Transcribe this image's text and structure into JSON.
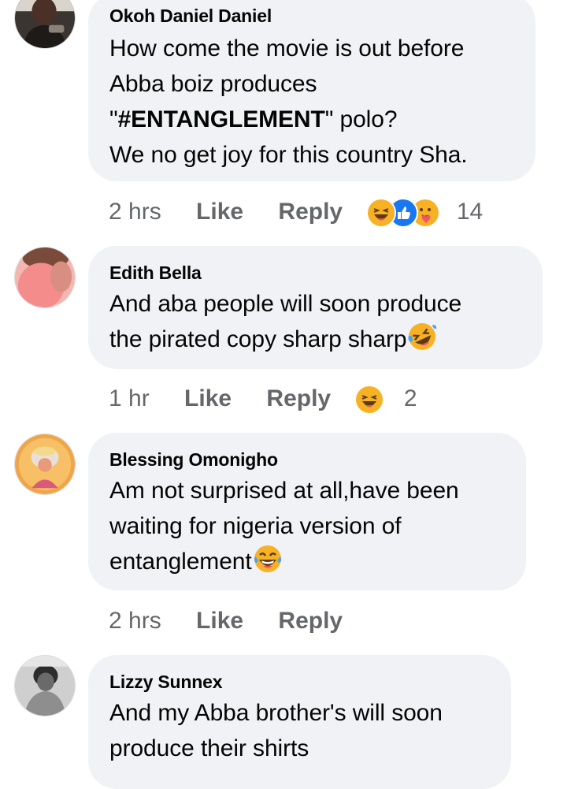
{
  "comments": [
    {
      "author": "Okoh Daniel Daniel",
      "lines": [
        "How come the movie is out before",
        "Abba boiz produces",
        "\"",
        "#ENTANGLEMENT",
        "\" polo?",
        "We no get joy for this country Sha."
      ],
      "time": "2 hrs",
      "like": "Like",
      "reply": "Reply",
      "reaction_icons": [
        "haha-icon",
        "like-icon",
        "care-icon"
      ],
      "reaction_count": "14"
    },
    {
      "author": "Edith Bella",
      "lines": [
        "And aba  people will  soon produce",
        "the pirated copy sharp sharp"
      ],
      "trailing_emoji": "rolling-laughing-emoji-icon",
      "time": "1 hr",
      "like": "Like",
      "reply": "Reply",
      "reaction_icons": [
        "haha-icon"
      ],
      "reaction_count": "2"
    },
    {
      "author": "Blessing Omonigho",
      "lines": [
        "Am not surprised at all,have been",
        "waiting for nigeria version of",
        "entanglement"
      ],
      "trailing_emoji": "tears-of-joy-emoji-icon",
      "time": "2 hrs",
      "like": "Like",
      "reply": "Reply"
    },
    {
      "author": "Lizzy Sunnex",
      "lines": [
        "And my Abba brother's will soon",
        "produce their shirts"
      ]
    }
  ],
  "colors": {
    "bubble": "#f0f2f5",
    "meta_text": "#65676b",
    "main_text": "#050505",
    "like_blue": "#1877f2",
    "haha_yellow": "#f7b125"
  }
}
